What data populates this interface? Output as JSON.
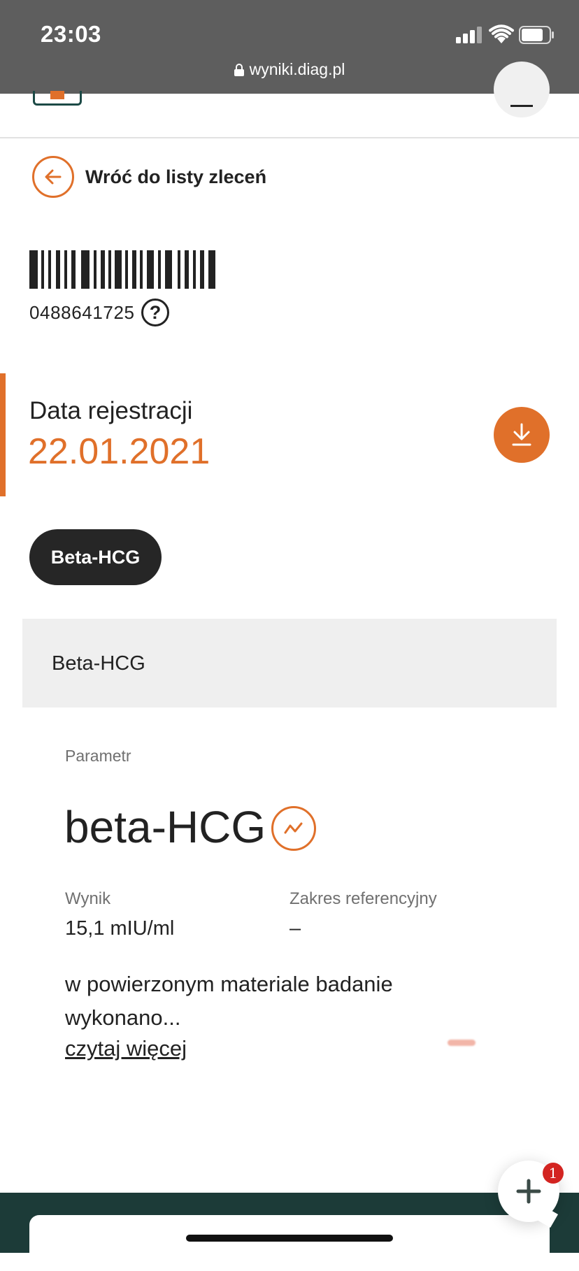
{
  "status_bar": {
    "time": "23:03",
    "url": "wyniki.diag.pl"
  },
  "back_link": {
    "label": "Wróć do listy zleceń"
  },
  "barcode": {
    "number": "0488641725",
    "help_symbol": "?"
  },
  "registration": {
    "label": "Data rejestracji",
    "date": "22.01.2021"
  },
  "test_pill": {
    "label": "Beta-HCG"
  },
  "section": {
    "title": "Beta-HCG",
    "parameter_label": "Parametr",
    "parameter_name": "beta-HCG",
    "result_label": "Wynik",
    "result_value": "15,1 mIU/ml",
    "reference_label": "Zakres referencyjny",
    "reference_value": "–",
    "comment": "w powierzonym materiale badanie wykonano...",
    "read_more": "czytaj więcej"
  },
  "chat": {
    "badge_count": "1"
  },
  "colors": {
    "accent": "#e0702a",
    "dark": "#262626",
    "footer": "#1c3b38",
    "badge": "#d32421"
  },
  "icons": [
    "lock-icon",
    "back-arrow-icon",
    "help-icon",
    "download-icon",
    "trend-chart-icon",
    "plus-icon",
    "menu-icon"
  ]
}
